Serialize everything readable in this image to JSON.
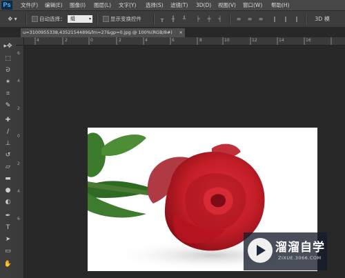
{
  "app": {
    "logo": "Ps"
  },
  "menu": [
    "文件(F)",
    "编辑(E)",
    "图像(I)",
    "图层(L)",
    "文字(Y)",
    "选择(S)",
    "滤镜(T)",
    "3D(D)",
    "视图(V)",
    "窗口(W)",
    "帮助(H)"
  ],
  "options": {
    "auto_select_label": "自动选择：",
    "auto_select_value": "组",
    "transform_label": "显示变换控件"
  },
  "document": {
    "tab_title": "u=3100955338,4352154489&fm=27&gp=0.jpg @ 100%(RGB/8#)",
    "close_glyph": "×"
  },
  "rulers": {
    "top": [
      "4",
      "2",
      "0",
      "2",
      "4",
      "6",
      "8",
      "10",
      "12",
      "14",
      "16"
    ],
    "left": [
      "6",
      "4",
      "2",
      "0",
      "2",
      "4",
      "6"
    ]
  },
  "tools": [
    "move-icon",
    "marquee-icon",
    "lasso-icon",
    "magic-wand-icon",
    "crop-icon",
    "eyedropper-icon",
    "healing-brush-icon",
    "brush-icon",
    "clone-stamp-icon",
    "history-brush-icon",
    "eraser-icon",
    "gradient-icon",
    "blur-icon",
    "dodge-icon",
    "pen-icon",
    "type-icon",
    "path-select-icon",
    "rectangle-icon",
    "hand-icon"
  ],
  "watermark": {
    "brand": "溜溜自学",
    "url": "ZIXUE.3066.COM"
  },
  "colors": {
    "menubar": "#474747",
    "optionsbar": "#3c3c3c",
    "workspace": "#282828",
    "accent": "#57b4ff",
    "rose": "#c8202a"
  }
}
